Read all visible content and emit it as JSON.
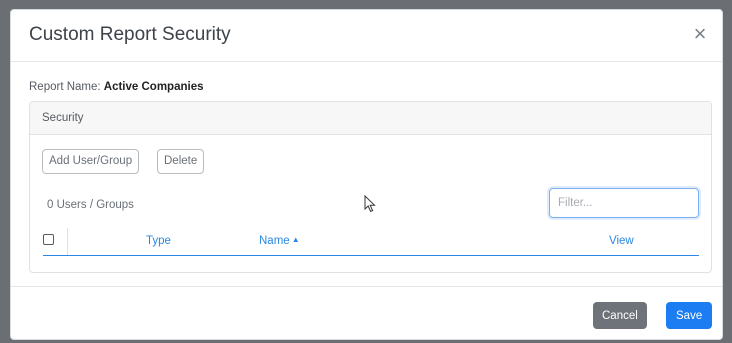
{
  "dialog": {
    "title": "Custom Report Security",
    "close_icon": "close-icon",
    "close_glyph": "×"
  },
  "report": {
    "name_label": "Report Name: ",
    "name_value": "Active Companies"
  },
  "security_panel": {
    "title": "Security",
    "add_button_label": "Add User/Group",
    "delete_button_label": "Delete",
    "count_text": "0 Users / Groups",
    "filter_placeholder": "Filter...",
    "filter_value": "",
    "columns": [
      {
        "label": "Type"
      },
      {
        "label": "Name",
        "sort_icon": "sort-ascending-icon",
        "sort_glyph": "▲"
      },
      {
        "label": "View"
      }
    ]
  },
  "footer": {
    "cancel_label": "Cancel",
    "save_label": "Save"
  },
  "colors": {
    "primary": "#1c7cf1",
    "secondary": "#6d7379",
    "link": "#2b87e3"
  }
}
